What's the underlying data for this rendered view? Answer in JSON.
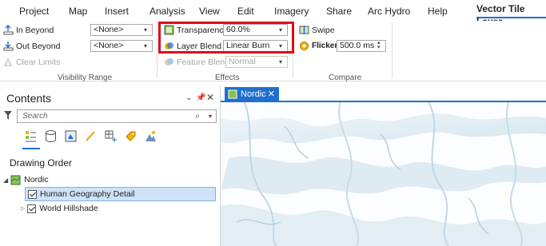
{
  "ribbon_tabs": [
    "Project",
    "Map",
    "Insert",
    "Analysis",
    "View",
    "Edit",
    "Imagery",
    "Share",
    "Arc Hydro",
    "Help",
    "Vector Tile Layer"
  ],
  "active_tab": "Vector Tile Layer",
  "visibility_range": {
    "in_beyond_label": "In Beyond",
    "in_beyond_value": "<None>",
    "out_beyond_label": "Out Beyond",
    "out_beyond_value": "<None>",
    "clear_limits_label": "Clear Limits",
    "group_label": "Visibility Range"
  },
  "effects": {
    "transparency_label": "Transparency",
    "transparency_value": "60.0%",
    "layer_blend_label": "Layer Blend",
    "layer_blend_value": "Linear Burn",
    "feature_blend_label": "Feature Blend",
    "feature_blend_value": "Normal",
    "group_label": "Effects"
  },
  "compare": {
    "swipe_label": "Swipe",
    "flicker_label": "Flicker",
    "flicker_value": "500.0 ms",
    "group_label": "Compare"
  },
  "contents": {
    "title": "Contents",
    "search_placeholder": "Search",
    "section": "Drawing Order",
    "map_name": "Nordic",
    "layers": [
      {
        "name": "Human Geography Detail",
        "checked": true,
        "selected": true
      },
      {
        "name": "World Hillshade",
        "checked": true,
        "selected": false
      }
    ]
  },
  "map_tab": {
    "label": "Nordic"
  },
  "colors": {
    "accent": "#1f6fd1",
    "highlight": "#d90f1e",
    "selection": "#cfe2f7"
  }
}
